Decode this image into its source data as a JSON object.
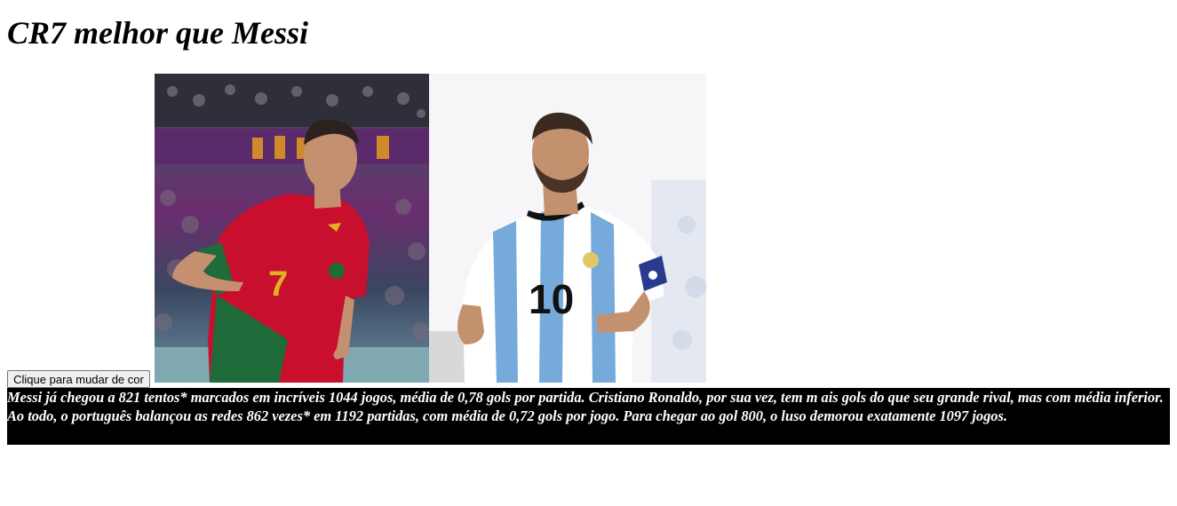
{
  "page": {
    "title": "CR7 melhor que Messi"
  },
  "button": {
    "label": "Clique para mudar de cor"
  },
  "images": {
    "left": {
      "subject": "cristiano-ronaldo-photo",
      "shirt_number": "7"
    },
    "right": {
      "subject": "lionel-messi-photo",
      "shirt_number": "10"
    }
  },
  "article": {
    "text": "Messi já chegou a 821 tentos* marcados em incríveis 1044 jogos, média de 0,78 gols por partida. Cristiano Ronaldo, por sua vez, tem m ais gols do que seu grande rival, mas com média inferior. Ao todo, o português balançou as redes 862 vezes* em 1192 partidas, com média de 0,72 gols por jogo. Para chegar ao gol 800, o luso demorou exatamente 1097 jogos."
  },
  "colors": {
    "text_block_background": "#000000",
    "text_block_foreground": "#ffffff",
    "portugal_red": "#c8102e",
    "portugal_green": "#1f6b3a",
    "argentina_blue": "#75aadb"
  }
}
